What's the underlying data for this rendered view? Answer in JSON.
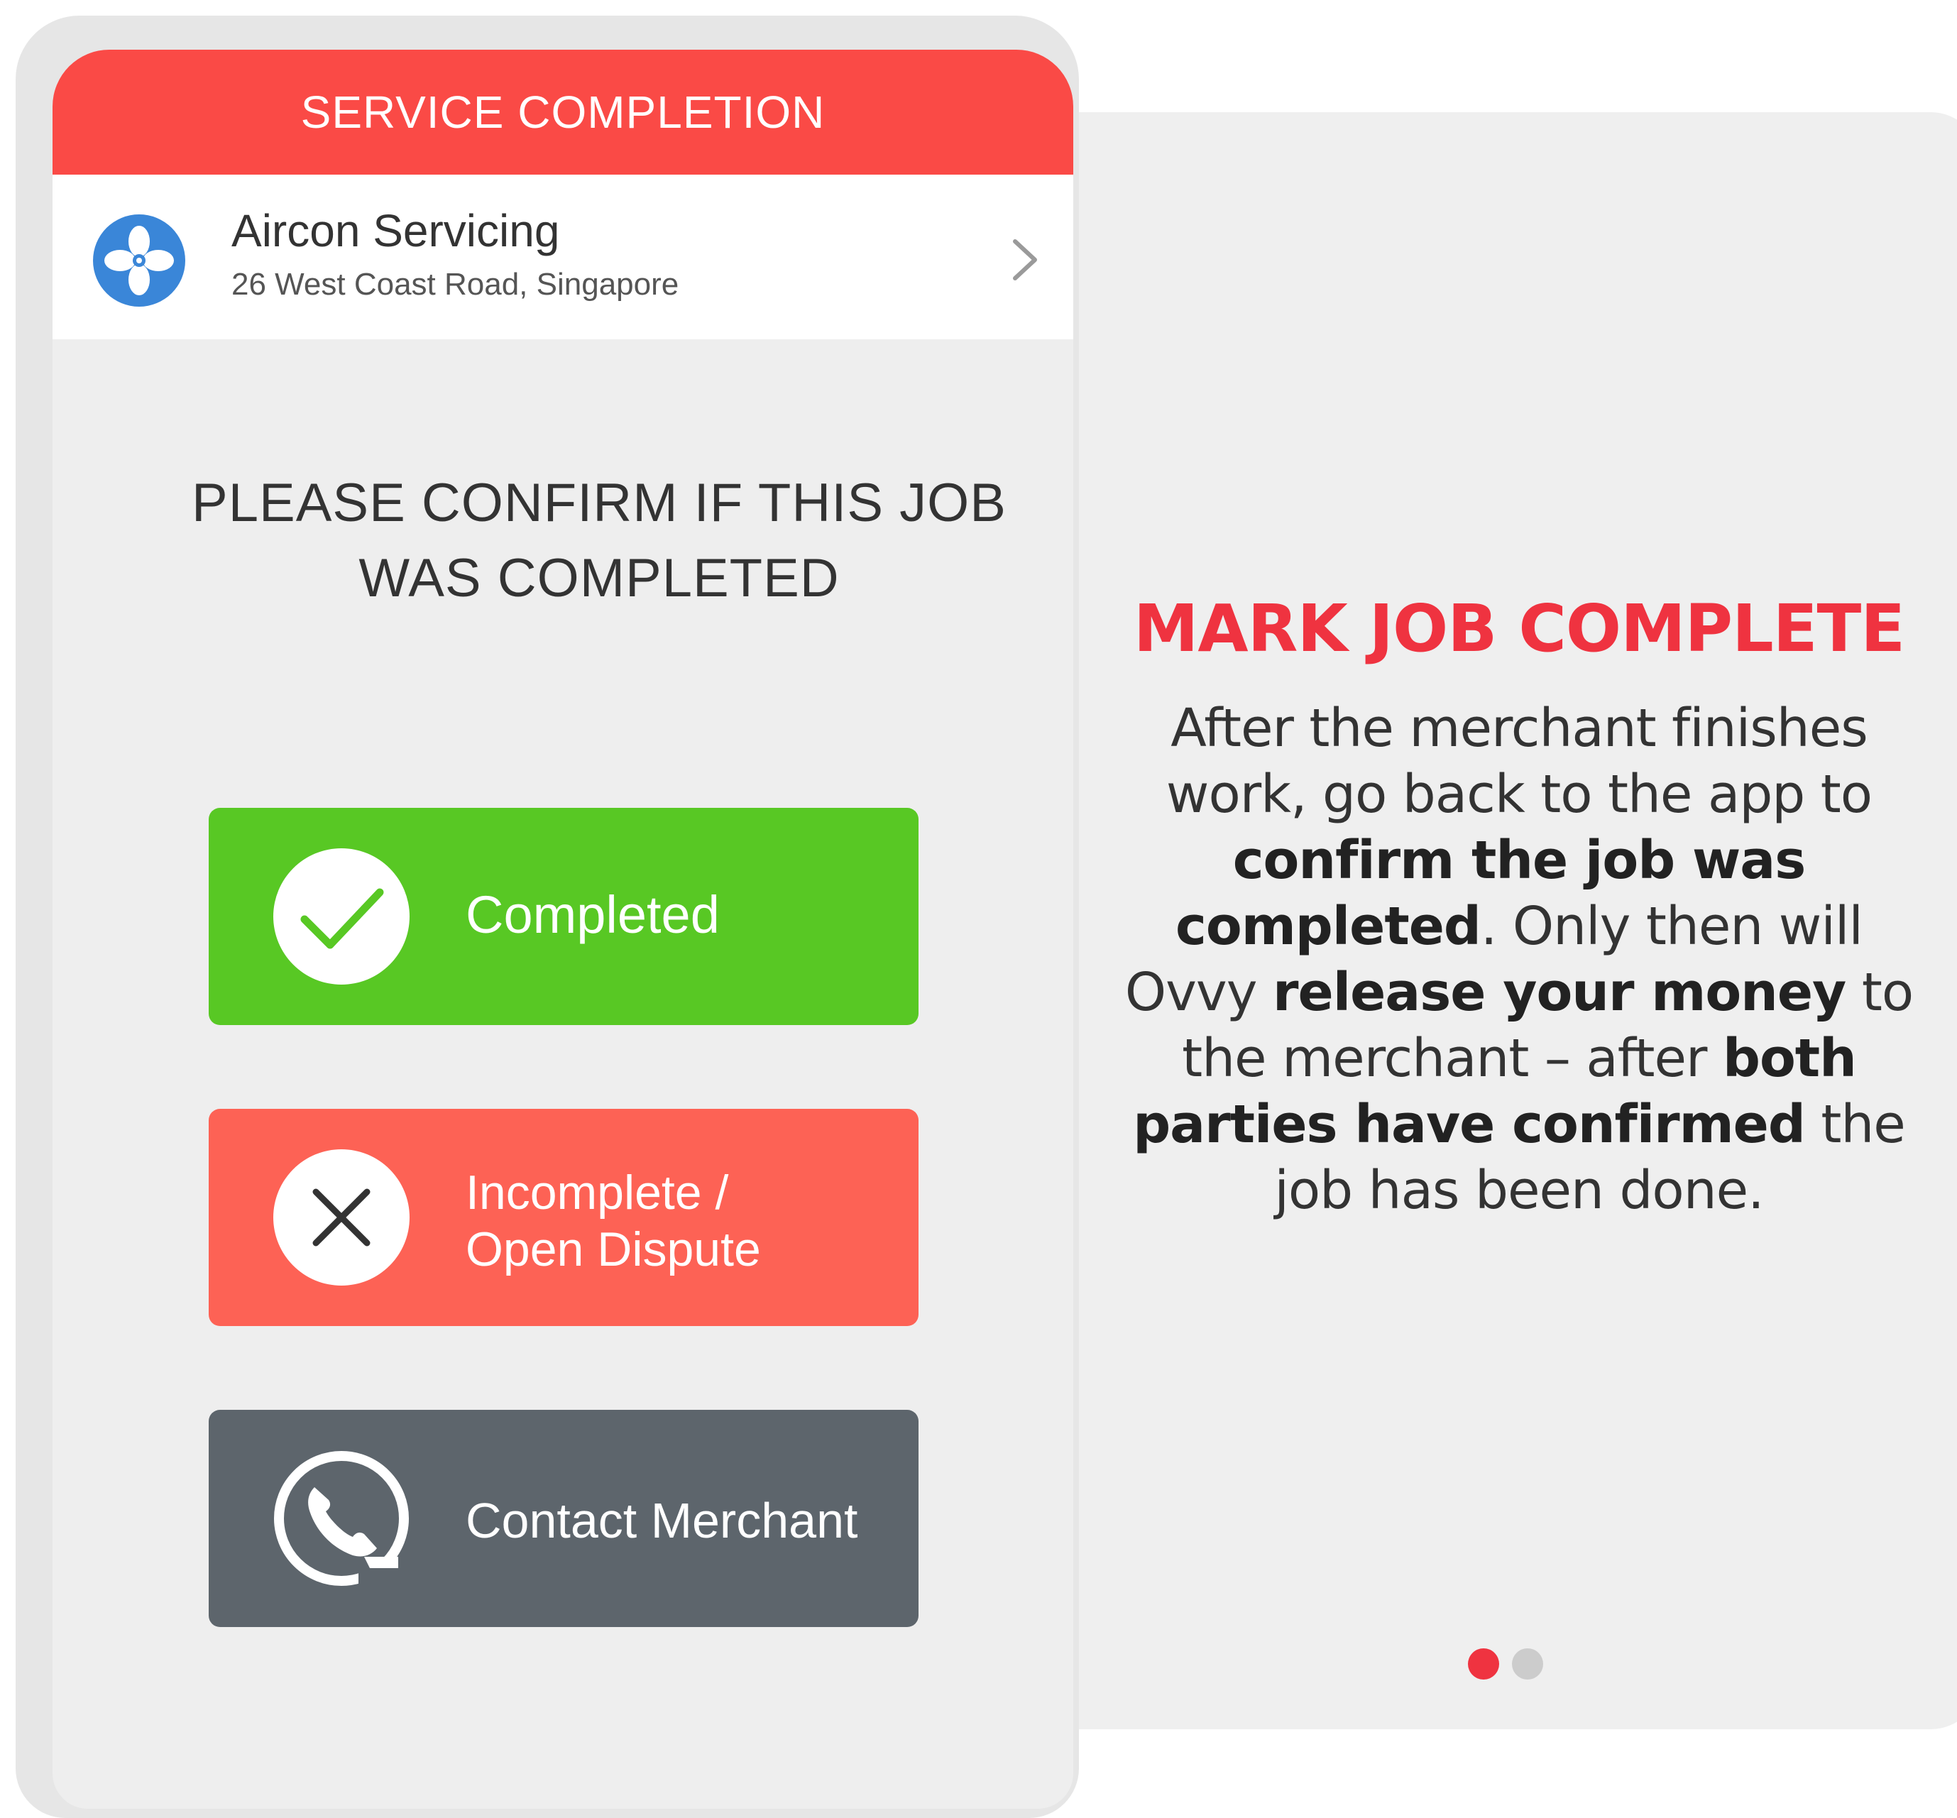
{
  "app": {
    "header_title": "SERVICE COMPLETION"
  },
  "service": {
    "name": "Aircon Servicing",
    "address": "26 West Coast Road, Singapore",
    "icon": "fan-icon"
  },
  "prompt": {
    "line1": "PLEASE CONFIRM IF THIS JOB",
    "line2": "WAS COMPLETED"
  },
  "actions": {
    "completed": {
      "label": "Completed",
      "icon": "checkmark-icon",
      "color": "#58c824"
    },
    "dispute": {
      "label_line1": "Incomplete /",
      "label_line2": "Open Dispute",
      "icon": "close-icon",
      "color": "#fd6255"
    },
    "contact": {
      "label": "Contact Merchant",
      "icon": "phone-icon",
      "color": "#5d656c"
    }
  },
  "info": {
    "title": "MARK JOB COMPLETE",
    "body": {
      "t1": "After the merchant finishes work, go back to the app to ",
      "b1": "confirm the job was completed",
      "t2": ". Only then will Ovvy ",
      "b2": "release your money",
      "t3": " to the merchant – after ",
      "b3": "both parties have confirmed",
      "t4": " the job has been done."
    }
  },
  "pager": {
    "total": 2,
    "active_index": 0
  },
  "colors": {
    "accent_red": "#ef3340",
    "header_red": "#fa4a46",
    "service_blue": "#3a86d8"
  }
}
